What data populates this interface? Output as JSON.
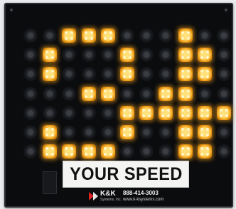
{
  "sign": {
    "digits": "24",
    "label": "YOUR SPEED",
    "phone": "888-414-3003",
    "website": "www.k-ksystems.com",
    "brand_name": "K&K",
    "brand_sub": "Systems, Inc.",
    "lit_color": "#f4a21a",
    "off_color": "#1b1d21",
    "background_color": "#0b0c0e",
    "matrix": [
      "..XXX...X..",
      ".X...X..XX.",
      ".X...X..XX.",
      "...XX..XX..",
      ".....XXXXXX",
      ".X...X..XX.",
      ".XXXX...XX."
    ]
  }
}
